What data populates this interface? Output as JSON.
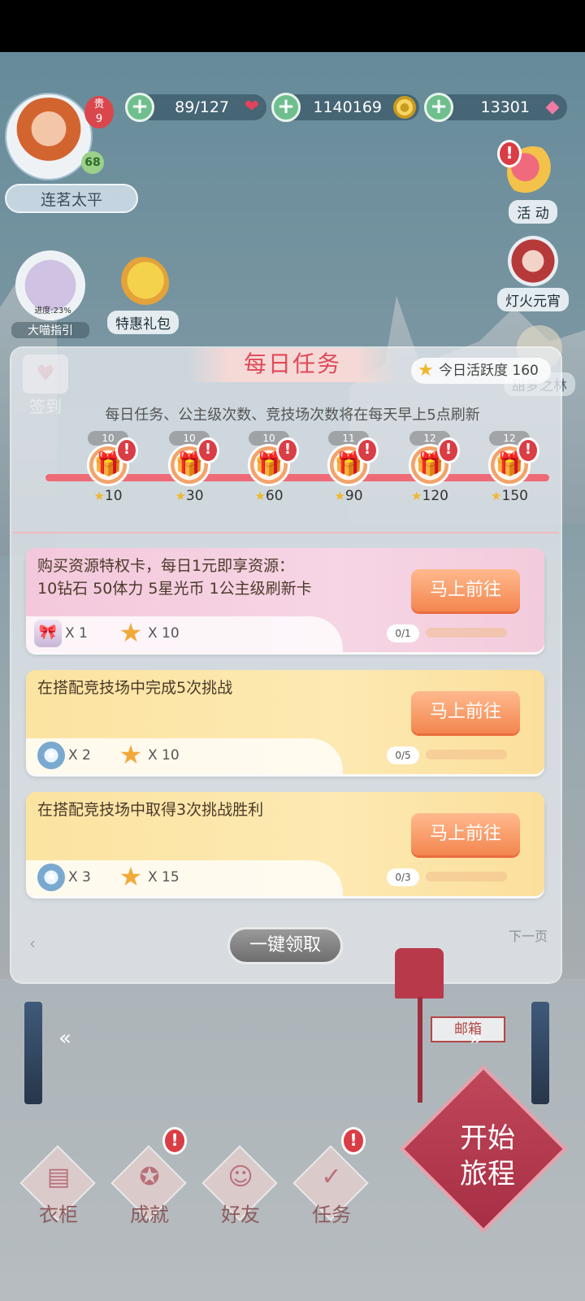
{
  "player": {
    "name": "连茗太平",
    "vip": "贵\n9",
    "level": "68"
  },
  "resources": [
    {
      "value": "89/127",
      "icon": "heart-icon",
      "glyph": "❤"
    },
    {
      "value": "1140169",
      "icon": "coin-icon",
      "glyph": "●"
    },
    {
      "value": "13301",
      "icon": "gem-icon",
      "glyph": "◆"
    }
  ],
  "side": {
    "activity": "活 动",
    "lantern": "灯火元宵",
    "dream": "甜梦之林",
    "guide_progress": "进度:23%",
    "guide": "大喵指引",
    "gift_pack": "特惠礼包",
    "signin": "签到"
  },
  "daily": {
    "title": "每日任务",
    "activity_label": "今日活跃度 160",
    "refresh_note": "每日任务、公主级次数、竞技场次数将在每天早上5点刷新",
    "milestones": [
      {
        "tag": "10",
        "points": "10"
      },
      {
        "tag": "10",
        "points": "30"
      },
      {
        "tag": "10",
        "points": "60"
      },
      {
        "tag": "11",
        "points": "90"
      },
      {
        "tag": "12",
        "points": "120"
      },
      {
        "tag": "12",
        "points": "150"
      }
    ],
    "tasks": [
      {
        "text": "购买资源特权卡，每日1元即享资源：\n10钻石 50体力 5星光币 1公主级刷新卡",
        "reward1": "X 1",
        "reward2": "X 10",
        "button": "马上前往",
        "progress": "0/1"
      },
      {
        "text": "在搭配竞技场中完成5次挑战",
        "reward1": "X 2",
        "reward2": "X 10",
        "button": "马上前往",
        "progress": "0/5"
      },
      {
        "text": "在搭配竞技场中取得3次挑战胜利",
        "reward1": "X 3",
        "reward2": "X 15",
        "button": "马上前往",
        "progress": "0/3"
      }
    ],
    "collect_all": "一键领取",
    "next_page": "下一页"
  },
  "mailbox": "邮箱",
  "start": "开始\n旅程",
  "nav": [
    {
      "label": "衣柜",
      "icon": "wardrobe-icon"
    },
    {
      "label": "成就",
      "icon": "achievement-icon"
    },
    {
      "label": "好友",
      "icon": "friends-icon"
    },
    {
      "label": "任务",
      "icon": "task-icon"
    }
  ],
  "colors": {
    "accent": "#e0495a",
    "button": "#f3864f",
    "progress_line": "#ef6a77"
  }
}
